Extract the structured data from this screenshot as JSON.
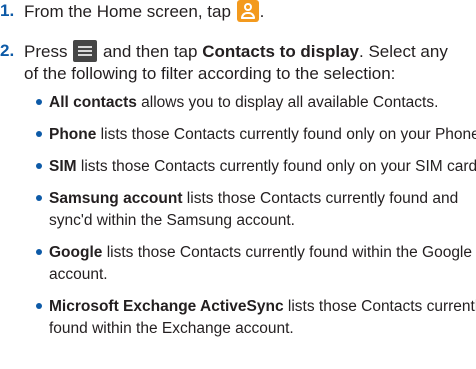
{
  "steps": [
    {
      "number": "1.",
      "before": "From the Home screen, tap",
      "after": "."
    },
    {
      "number": "2.",
      "press": "Press",
      "and_tap": "and then tap",
      "bold": "Contacts to display",
      "rest": ". Select any",
      "line2": "of the following to filter according to the selection:"
    }
  ],
  "icons": {
    "contacts_icon": "contacts-person-icon",
    "menu_icon": "menu-icon",
    "contacts_icon_color": "#f39a1e",
    "menu_icon_color": "#454545"
  },
  "bullets": [
    {
      "bold": "All contacts",
      "text": " allows you to display all available Contacts."
    },
    {
      "bold": "Phone",
      "text": " lists those Contacts currently found only on your Phone."
    },
    {
      "bold": "SIM",
      "text": " lists those Contacts currently found only on your SIM card."
    },
    {
      "bold": "Samsung account",
      "text": " lists those Contacts currently found and",
      "line2": "sync'd within the Samsung account."
    },
    {
      "bold": "Google",
      "text": " lists those Contacts currently found within the Google",
      "line2": "account."
    },
    {
      "bold": "Microsoft Exchange ActiveSync",
      "text": " lists those Contacts currently",
      "line2": "found within the Exchange account."
    }
  ],
  "colors": {
    "accent": "#0d5aa7",
    "text": "#231f20"
  }
}
